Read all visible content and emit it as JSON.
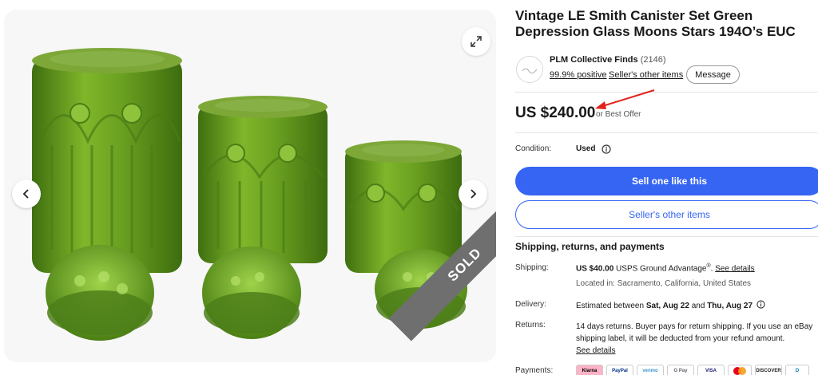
{
  "item": {
    "title": "Vintage LE Smith Canister Set Green Depression Glass Moons Stars 194O’s EUC",
    "sold_badge": "SOLD"
  },
  "gallery": {
    "expand_icon": "expand-arrows-icon",
    "prev_icon": "chevron-left-icon",
    "next_icon": "chevron-right-icon"
  },
  "seller": {
    "name": "PLM Collective Finds",
    "count": "(2146)",
    "positive": "99.9% positive",
    "separator": "·",
    "other_items": "Seller's other items",
    "message_label": "Message"
  },
  "price": {
    "amount": "US $240.00",
    "best_offer": "or Best Offer"
  },
  "condition": {
    "label": "Condition:",
    "value": "Used"
  },
  "actions": {
    "primary": "Sell one like this",
    "secondary": "Seller's other items"
  },
  "shipping": {
    "section_title": "Shipping, returns, and payments",
    "shipping_label": "Shipping:",
    "shipping_price": "US $40.00",
    "shipping_service": "USPS Ground Advantage",
    "shipping_mark": "®",
    "shipping_link": "See details",
    "location": "Located in: Sacramento, California, United States",
    "delivery_label": "Delivery:",
    "delivery_prefix": "Estimated between",
    "delivery_start": "Sat, Aug 22",
    "delivery_and": "and",
    "delivery_end": "Thu, Aug 27",
    "returns_label": "Returns:",
    "returns_text": "14 days returns. Buyer pays for return shipping. If you use an eBay shipping label, it will be deducted from your refund amount.",
    "returns_link": "See details",
    "payments_label": "Payments:"
  },
  "payment_methods": [
    "Klarna",
    "PayPal",
    "venmo",
    "G Pay",
    "VISA",
    "MC",
    "DISCOVER",
    "D"
  ],
  "colors": {
    "accent": "#3665f3",
    "glass": "#5f9a1c",
    "annotation_arrow": "#e0231c",
    "ribbon": "#6f6f6f"
  }
}
